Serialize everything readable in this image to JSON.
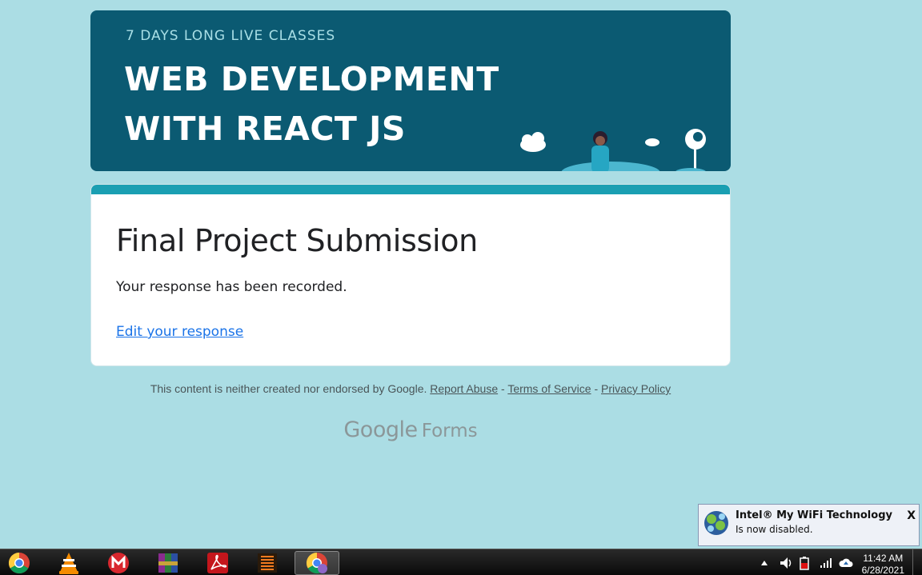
{
  "banner": {
    "subtitle": "7 DAYS LONG LIVE CLASSES",
    "line1": "WEB DEVELOPMENT",
    "line2": "WITH REACT JS"
  },
  "card": {
    "title": "Final Project Submission",
    "message": "Your response has been recorded.",
    "edit_link": "Edit your response"
  },
  "footer": {
    "disclaimer": "This content is neither created nor endorsed by Google.",
    "report_abuse": "Report Abuse",
    "sep1": " - ",
    "terms": "Terms of Service",
    "sep2": " - ",
    "privacy": "Privacy Policy"
  },
  "branding": {
    "google": "Google",
    "forms": "Forms"
  },
  "notification": {
    "title": "Intel® My WiFi Technology",
    "body": "Is now disabled.",
    "close": "X"
  },
  "taskbar": {
    "apps": [
      "chrome-icon",
      "vlc-icon",
      "mega-icon",
      "winrar-icon",
      "acrobat-icon",
      "spring-app-icon",
      "chrome-active-icon"
    ],
    "time": "11:42 AM",
    "date": "6/28/2021"
  },
  "colors": {
    "page_bg": "#abdde4",
    "banner_bg": "#0b5a72",
    "accent": "#1a9fb2",
    "link": "#1a73e8"
  }
}
